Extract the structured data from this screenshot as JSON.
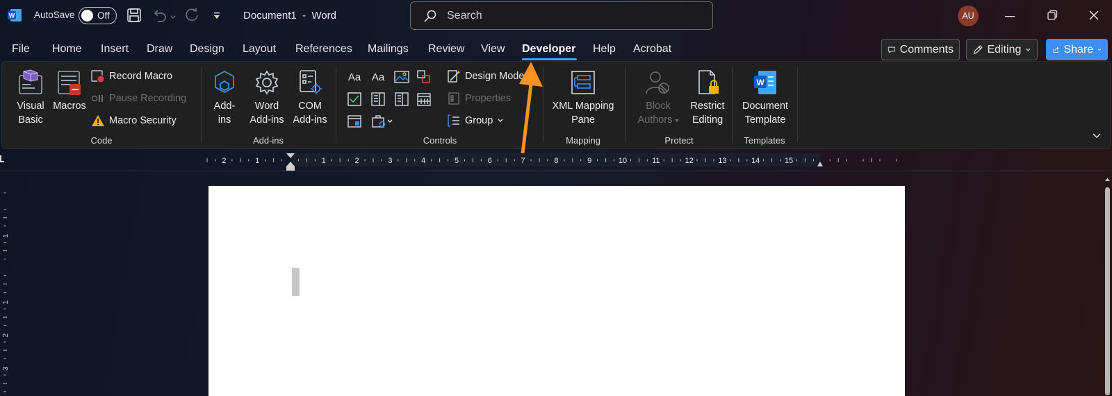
{
  "titlebar": {
    "autosave_label": "AutoSave",
    "autosave_state": "Off",
    "doc_title": "Document1",
    "separator": "-",
    "app_name": "Word",
    "search_placeholder": "Search",
    "avatar_initials": "AU"
  },
  "tabs": [
    {
      "label": "File"
    },
    {
      "label": "Home"
    },
    {
      "label": "Insert"
    },
    {
      "label": "Draw"
    },
    {
      "label": "Design"
    },
    {
      "label": "Layout"
    },
    {
      "label": "References"
    },
    {
      "label": "Mailings"
    },
    {
      "label": "Review"
    },
    {
      "label": "View"
    },
    {
      "label": "Developer",
      "active": true
    },
    {
      "label": "Help"
    },
    {
      "label": "Acrobat"
    }
  ],
  "actions": {
    "comments": "Comments",
    "editing": "Editing",
    "share": "Share"
  },
  "ribbon": {
    "code": {
      "label": "Code",
      "visual_basic_l1": "Visual",
      "visual_basic_l2": "Basic",
      "macros": "Macros",
      "record_macro": "Record Macro",
      "pause_recording": "Pause Recording",
      "macro_security": "Macro Security"
    },
    "addins": {
      "label": "Add-ins",
      "addins_l1": "Add-",
      "addins_l2": "ins",
      "word_l1": "Word",
      "word_l2": "Add-ins",
      "com_l1": "COM",
      "com_l2": "Add-ins"
    },
    "controls": {
      "label": "Controls",
      "design_mode": "Design Mode",
      "properties": "Properties",
      "group": "Group",
      "aa1": "Aa",
      "aa2": "Aa"
    },
    "mapping": {
      "label": "Mapping",
      "xml_l1": "XML Mapping",
      "xml_l2": "Pane"
    },
    "protect": {
      "label": "Protect",
      "block_l1": "Block",
      "block_l2": "Authors",
      "restrict_l1": "Restrict",
      "restrict_l2": "Editing"
    },
    "templates": {
      "label": "Templates",
      "doc_l1": "Document",
      "doc_l2": "Template"
    }
  },
  "ruler_numbers": [
    "2",
    "1",
    "1",
    "2",
    "3",
    "4",
    "5",
    "6",
    "7",
    "8",
    "9",
    "10",
    "11",
    "12",
    "13",
    "14",
    "15"
  ],
  "vruler_numbers": [
    "1",
    "1",
    "2",
    "3"
  ],
  "colors": {
    "accent_blue": "#4aa0ff",
    "share_bg": "#3e8ef7",
    "arrow": "#f7931e",
    "ribbon_bg": "#202020"
  }
}
